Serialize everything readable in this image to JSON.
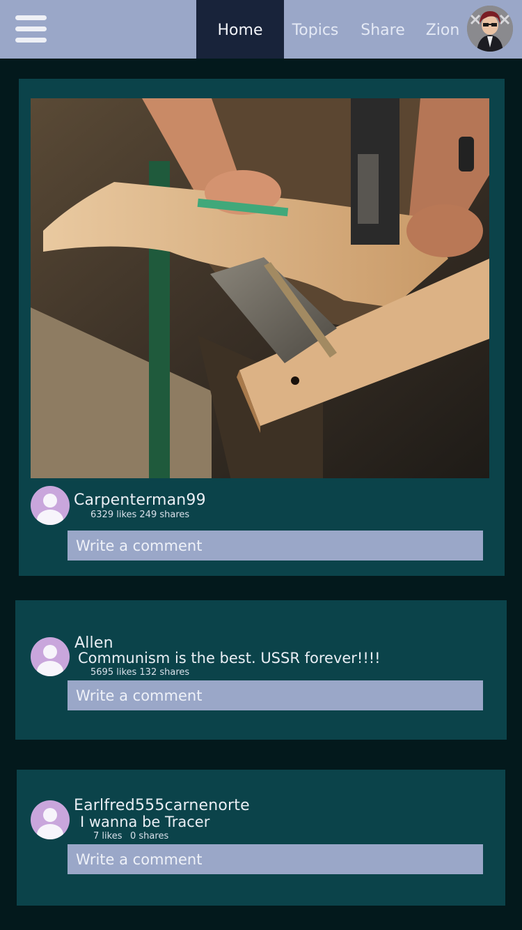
{
  "header": {
    "tabs": [
      {
        "label": "Home",
        "active": true
      },
      {
        "label": "Topics",
        "active": false
      },
      {
        "label": "Share",
        "active": false
      },
      {
        "label": "Zion",
        "active": false
      }
    ]
  },
  "posts": [
    {
      "username": "Carpenterman99",
      "message": "",
      "stats": "6329 likes 249 shares",
      "image": "carpenter-cutting-wood-photo",
      "comment_placeholder": "Write a comment"
    },
    {
      "username": "Allen",
      "message": "Communism is the best. USSR forever!!!!",
      "stats": "5695 likes 132 shares",
      "comment_placeholder": "Write a comment"
    },
    {
      "username": "Earlfred555carnenorte",
      "message": "I wanna be Tracer",
      "likes": "7 likes",
      "shares": "0 shares",
      "comment_placeholder": "Write a comment"
    }
  ],
  "colors": {
    "background": "#03191c",
    "topbar": "#9aa7c8",
    "active_tab": "#18233a",
    "card": "#0b434a",
    "input": "#9aa7c8",
    "avatar": "#c9a6dc"
  }
}
